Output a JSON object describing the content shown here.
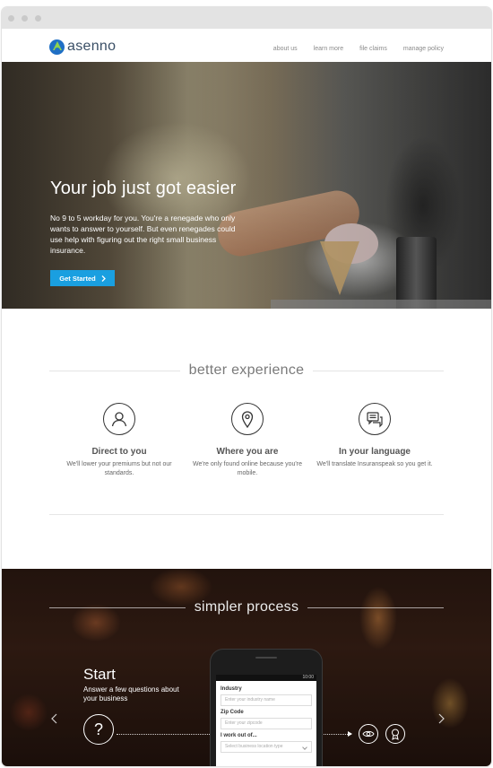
{
  "nav": {
    "logo_text": "asenno",
    "links": [
      "about us",
      "learn more",
      "file claims",
      "manage policy"
    ]
  },
  "hero": {
    "title": "Your job just got easier",
    "body": "No 9 to 5 workday for you. You're a renegade who only wants to answer to yourself. But even renegades could use help with figuring out the right small business insurance.",
    "cta_label": "Get Started",
    "cta_icon": "chevron-right-icon"
  },
  "features": {
    "heading": "better experience",
    "items": [
      {
        "icon": "user-icon",
        "title": "Direct to you",
        "text": "We'll lower your premiums but not our standards."
      },
      {
        "icon": "location-pin-icon",
        "title": "Where you are",
        "text": "We're only found online because you're mobile."
      },
      {
        "icon": "chat-bubbles-icon",
        "title": "In your language",
        "text": "We'll translate Insuranspeak so you get it."
      }
    ]
  },
  "process": {
    "heading": "simpler process",
    "step_title": "Start",
    "step_text": "Answer a few questions about your business",
    "step_icon": "question-icon",
    "next_icons": [
      "eye-icon",
      "award-icon"
    ],
    "phone": {
      "status_time": "10:00",
      "fields": [
        {
          "label": "Industry",
          "placeholder": "Enter your industry name",
          "type": "input"
        },
        {
          "label": "Zip Code",
          "placeholder": "Enter your zipcode",
          "type": "input"
        },
        {
          "label": "I work out of...",
          "placeholder": "Select business location type",
          "type": "select"
        }
      ]
    }
  },
  "colors": {
    "accent": "#1a9fe0",
    "logo_blue": "#1f6fc5",
    "logo_green": "#8fd14f"
  }
}
